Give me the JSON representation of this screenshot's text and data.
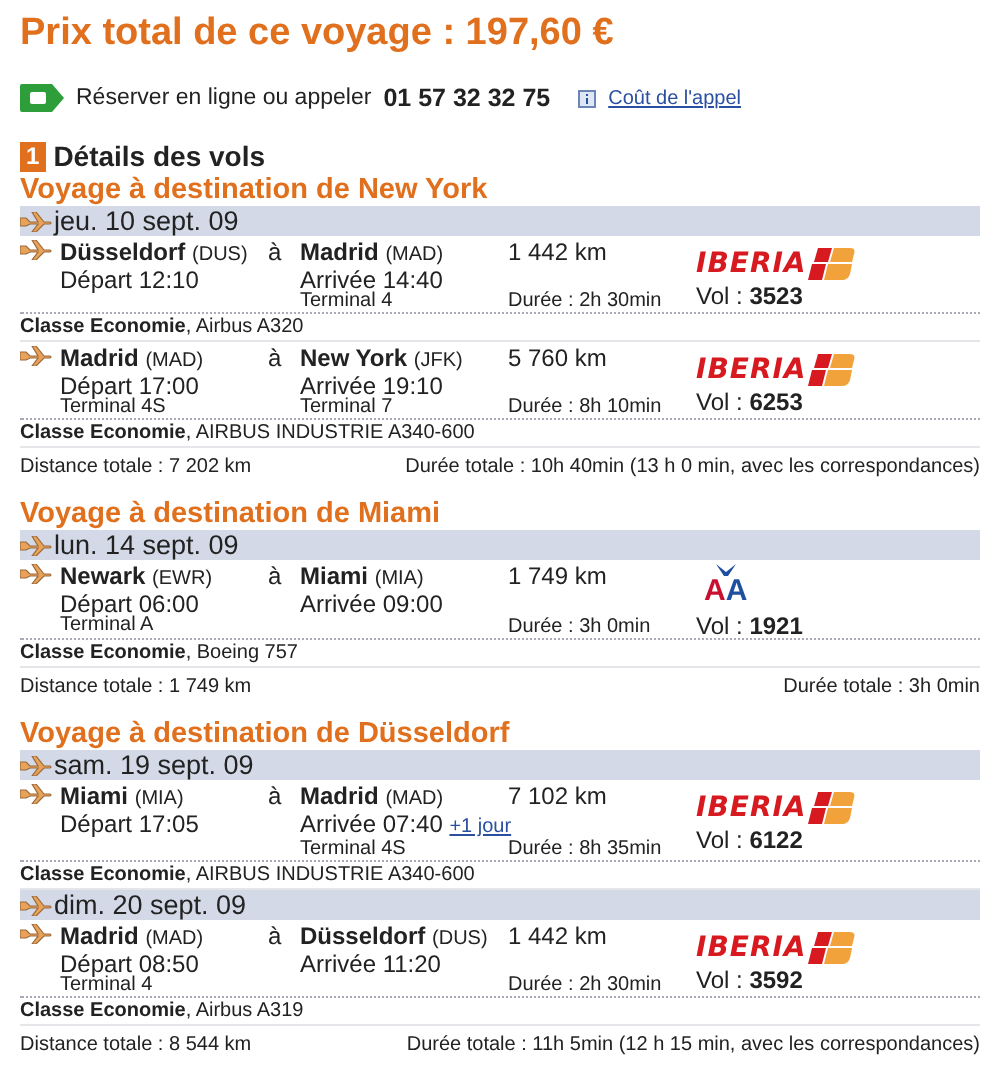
{
  "title": "Prix total de ce voyage : 197,60 €",
  "booking": {
    "text": "Réserver en ligne ou appeler",
    "phone": "01 57 32 32 75",
    "link": "Coût de l'appel"
  },
  "section": {
    "number": "1",
    "title": "Détails des vols"
  },
  "trips": [
    {
      "title": "Voyage à destination de New York",
      "days": [
        {
          "date": "jeu. 10 sept. 09",
          "flights": [
            {
              "origin": "Düsseldorf",
              "origin_code": "(DUS)",
              "departure": "Départ 12:10",
              "to_word": "à",
              "destination": "Madrid",
              "destination_code": "(MAD)",
              "arrival": "Arrivée 14:40",
              "destination_terminal": "Terminal 4",
              "distance": "1 442 km",
              "duration": "Durée : 2h 30min",
              "airline": {
                "kind": "iberia",
                "logo": "IBERIA"
              },
              "flight_label": "Vol :",
              "flight_number": "3523",
              "cabin": "**Classe Economie**, Airbus A320"
            },
            {
              "origin": "Madrid",
              "origin_code": "(MAD)",
              "departure": "Départ 17:00",
              "origin_terminal": "Terminal 4S",
              "to_word": "à",
              "destination": "New York",
              "destination_code": "(JFK)",
              "arrival": "Arrivée 19:10",
              "destination_terminal": "Terminal 7",
              "distance": "5 760 km",
              "duration": "Durée : 8h 10min",
              "airline": {
                "kind": "iberia",
                "logo": "IBERIA"
              },
              "flight_label": "Vol :",
              "flight_number": "6253",
              "cabin": "**Classe Economie**, AIRBUS INDUSTRIE A340-600"
            }
          ]
        }
      ],
      "distance": "Distance totale : 7 202 km",
      "duration": "Durée totale : 10h 40min (13 h 0 min, avec les correspondances)"
    },
    {
      "title": "Voyage à destination de Miami",
      "days": [
        {
          "date": "lun. 14 sept. 09",
          "flights": [
            {
              "origin": "Newark",
              "origin_code": "(EWR)",
              "departure": "Départ 06:00",
              "origin_terminal": "Terminal A",
              "to_word": "à",
              "destination": "Miami",
              "destination_code": "(MIA)",
              "arrival": "Arrivée 09:00",
              "distance": "1 749 km",
              "duration": "Durée : 3h 0min",
              "airline": {
                "kind": "aa",
                "logo": "AA"
              },
              "flight_label": "Vol :",
              "flight_number": "1921",
              "cabin": "**Classe Economie**, Boeing 757"
            }
          ]
        }
      ],
      "distance": "Distance totale : 1 749 km",
      "duration": "Durée totale : 3h 0min"
    },
    {
      "title": "Voyage à destination de Düsseldorf",
      "days": [
        {
          "date": "sam. 19 sept. 09",
          "flights": [
            {
              "origin": "Miami",
              "origin_code": "(MIA)",
              "departure": "Départ 17:05",
              "to_word": "à",
              "destination": "Madrid",
              "destination_code": "(MAD)",
              "arrival": "Arrivée 07:40",
              "next_day": "+1 jour",
              "destination_terminal": "Terminal 4S",
              "distance": "7 102 km",
              "duration": "Durée : 8h 35min",
              "airline": {
                "kind": "iberia",
                "logo": "IBERIA"
              },
              "flight_label": "Vol :",
              "flight_number": "6122",
              "cabin": "**Classe Economie**, AIRBUS INDUSTRIE A340-600"
            }
          ]
        },
        {
          "date": "dim. 20 sept. 09",
          "flights": [
            {
              "origin": "Madrid",
              "origin_code": "(MAD)",
              "departure": "Départ 08:50",
              "origin_terminal": "Terminal 4",
              "to_word": "à",
              "destination": "Düsseldorf",
              "destination_code": "(DUS)",
              "arrival": "Arrivée 11:20",
              "distance": "1 442 km",
              "duration": "Durée : 2h 30min",
              "airline": {
                "kind": "iberia",
                "logo": "IBERIA"
              },
              "flight_label": "Vol :",
              "flight_number": "3592",
              "cabin": "**Classe Economie**, Airbus A319"
            }
          ]
        }
      ],
      "distance": "Distance totale : 8 544 km",
      "duration": "Durée totale : 11h 5min (12 h 15 min, avec les correspondances)"
    }
  ]
}
